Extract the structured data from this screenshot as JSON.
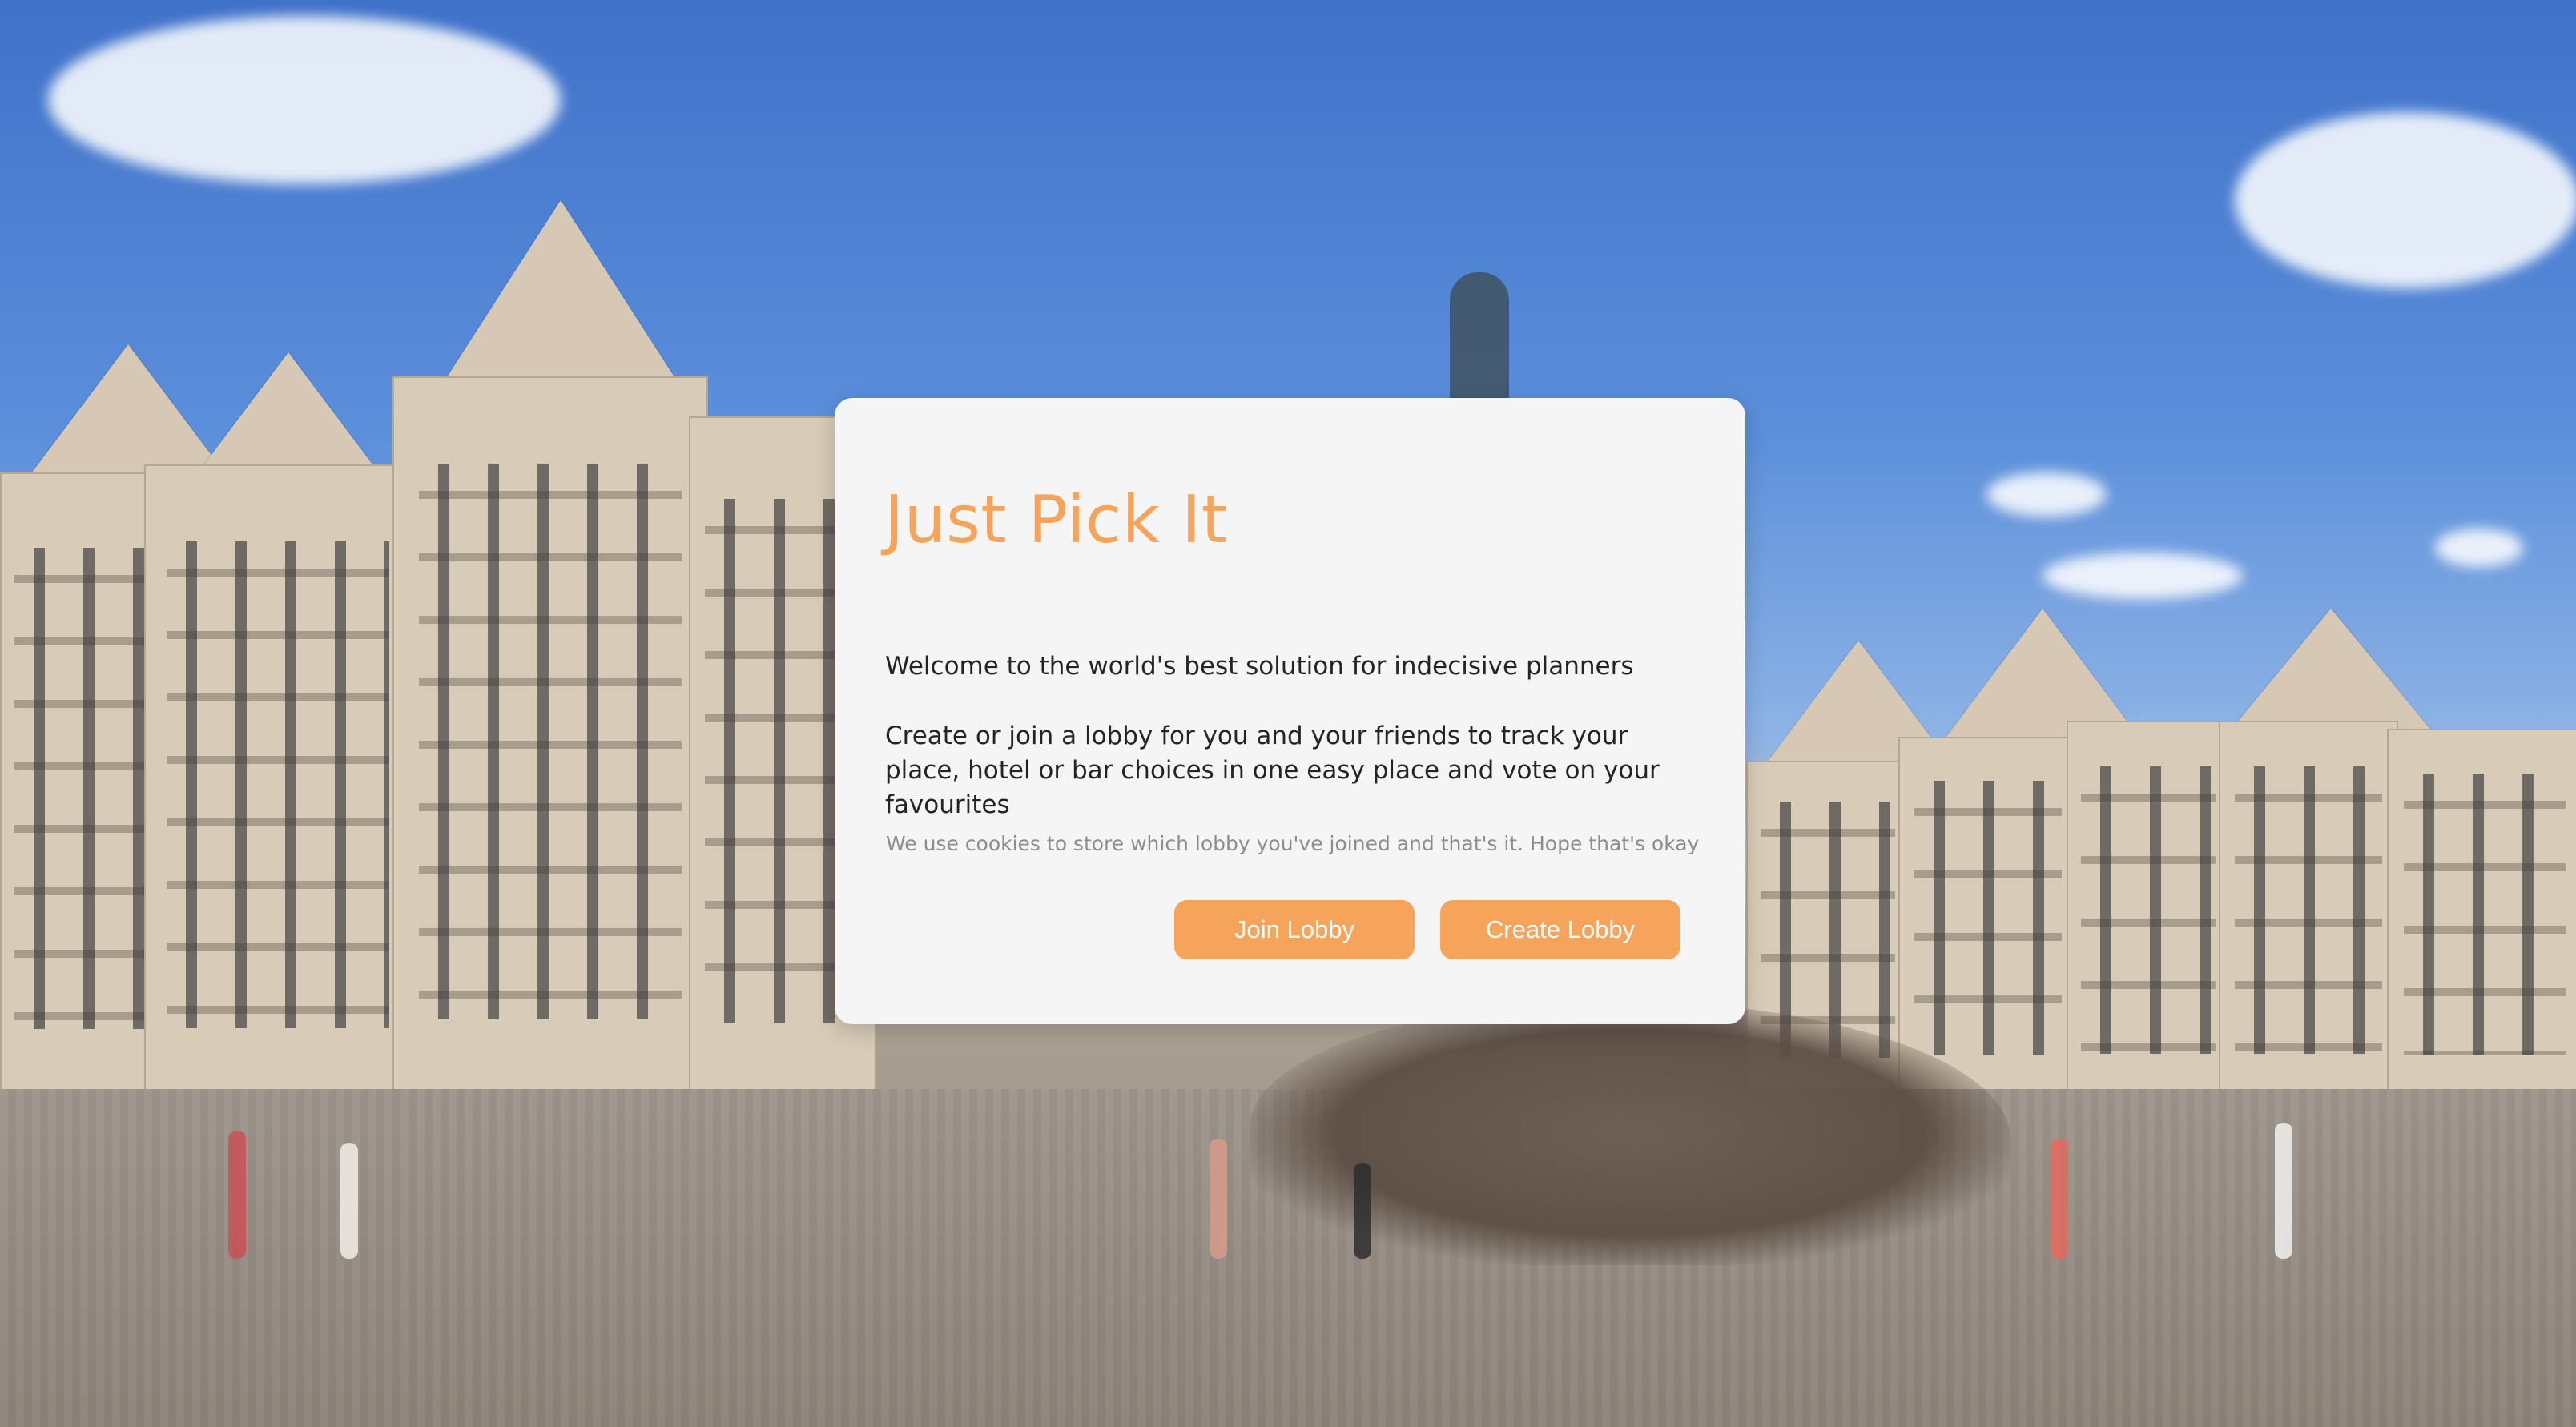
{
  "app": {
    "title": "Just Pick It"
  },
  "content": {
    "welcome": "Welcome to the world's best solution for indecisive planners",
    "description": "Create or join a lobby for you and your friends to track your place, hotel or bar choices in one easy place and vote on your favourites",
    "cookie_notice": "We use cookies to store which lobby you've joined and that's it. Hope that's okay"
  },
  "actions": {
    "join_label": "Join Lobby",
    "create_label": "Create Lobby"
  },
  "colors": {
    "accent": "#f6a35b",
    "panel_background": "#f5f5f5",
    "body_text": "#242424",
    "muted_text": "#8d8d8d"
  }
}
